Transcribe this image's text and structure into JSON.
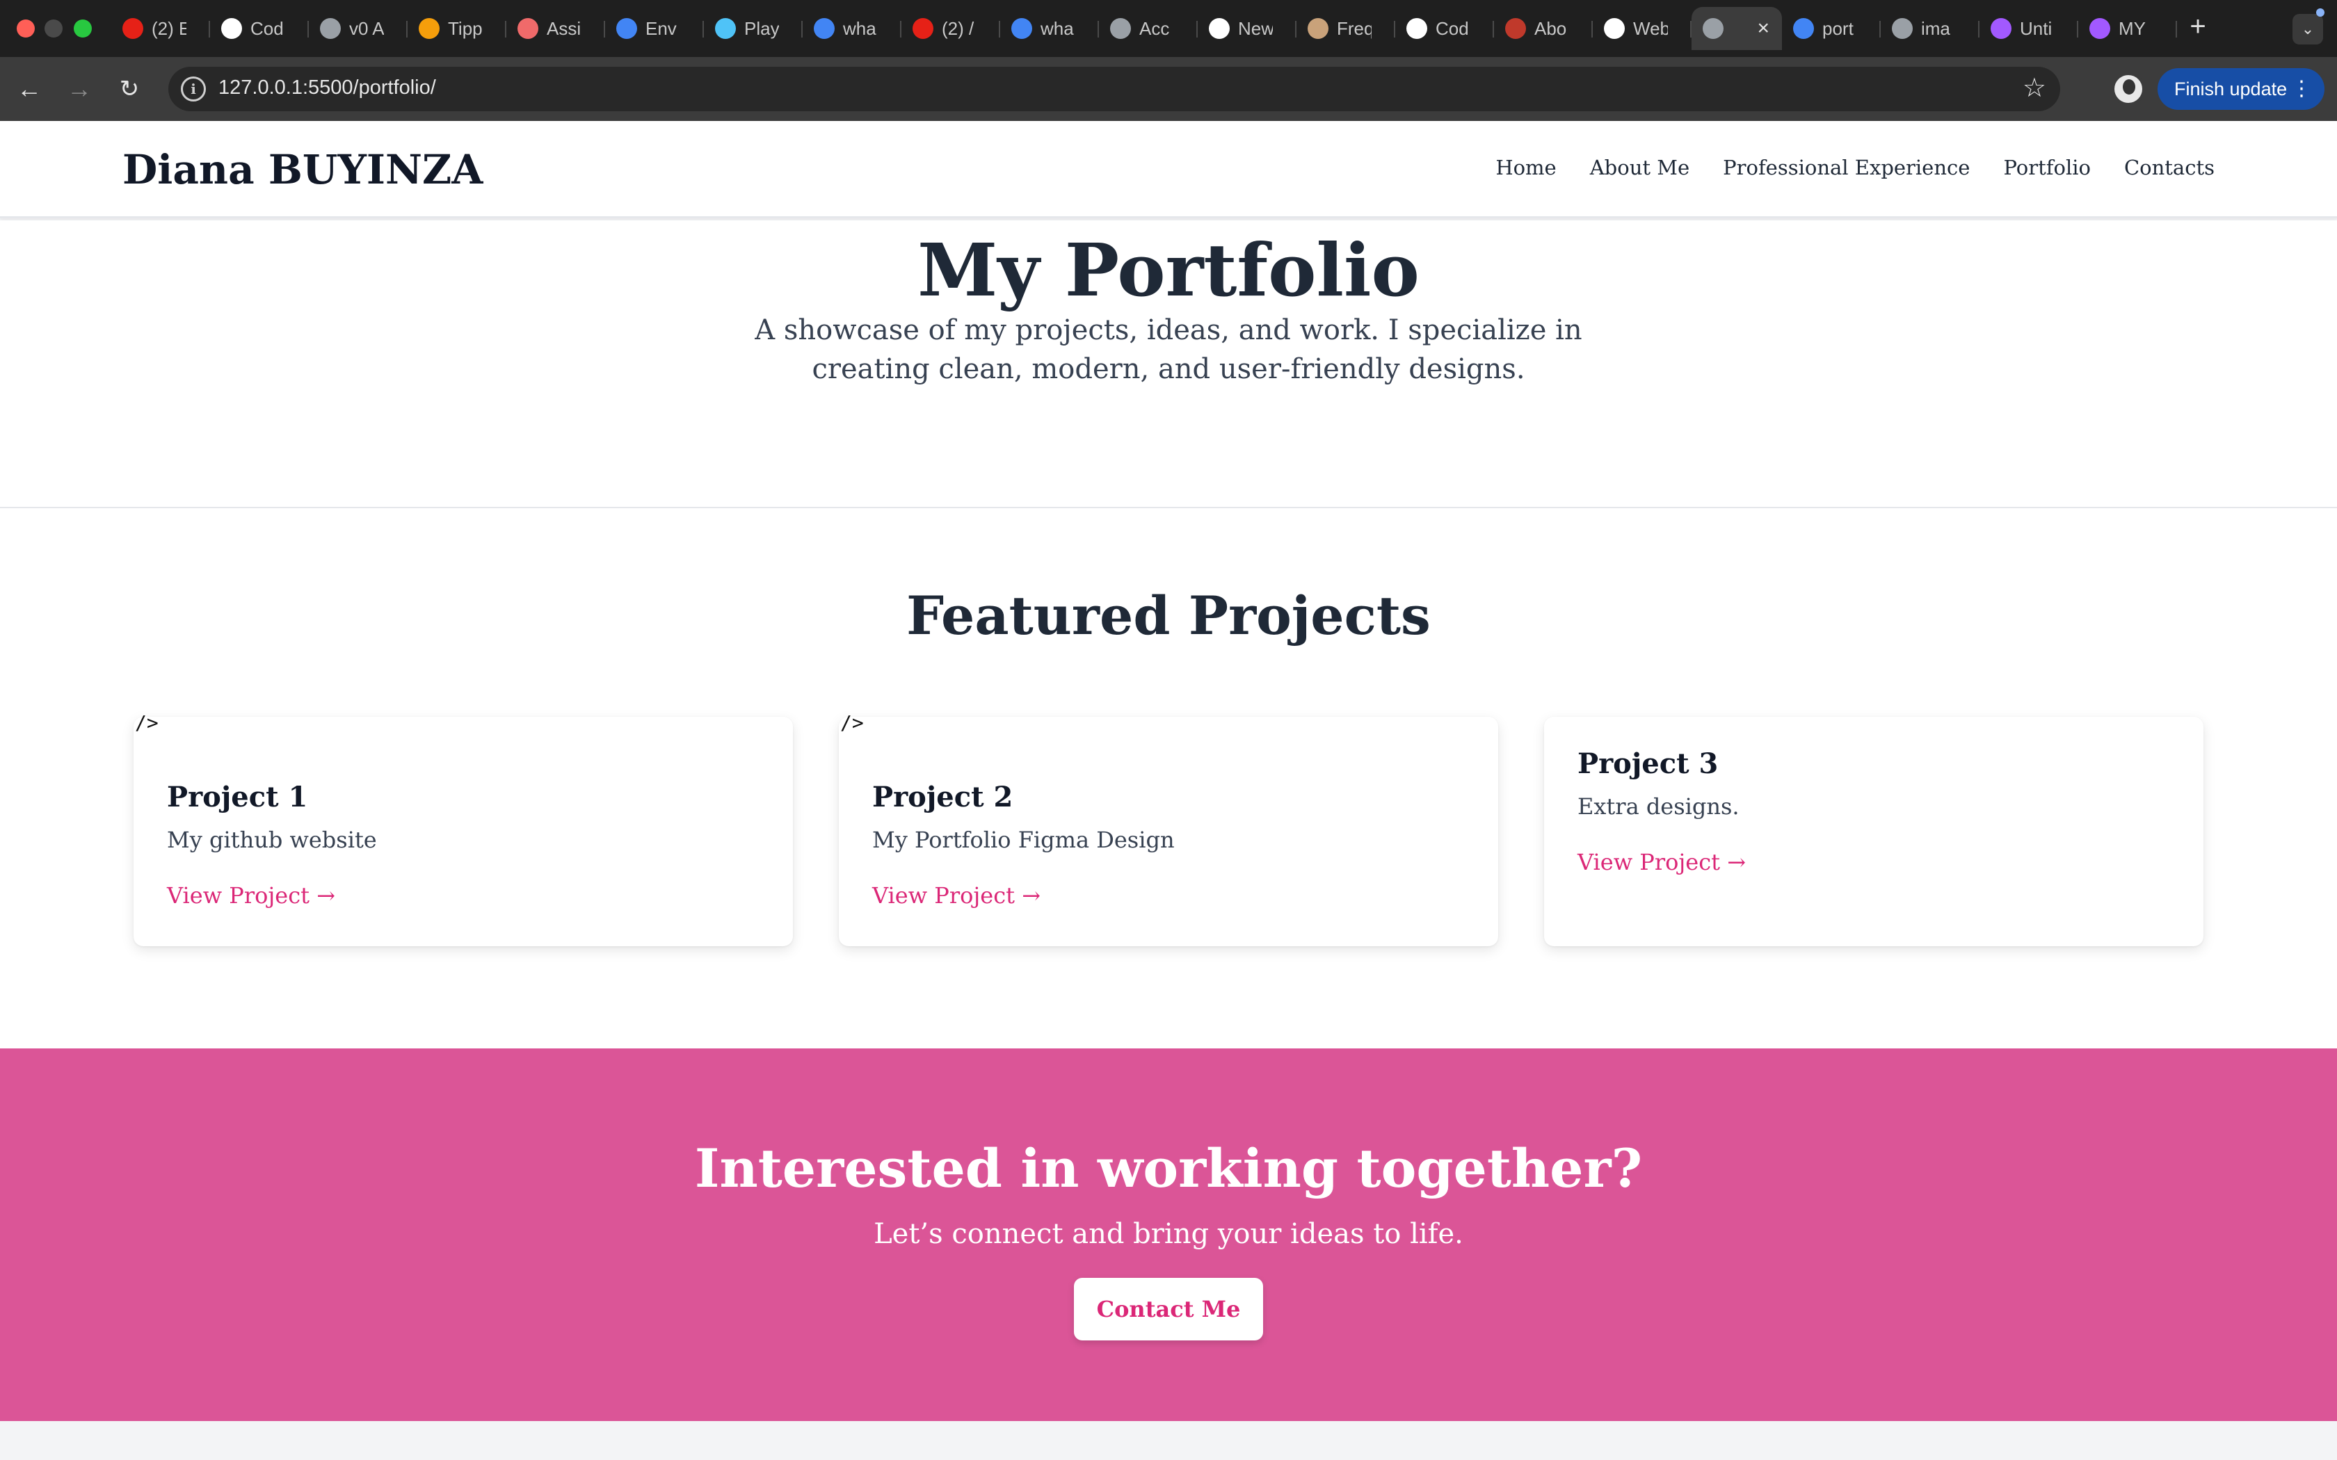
{
  "browser": {
    "tabs": [
      {
        "title": "(2) E",
        "icon": "youtube-icon",
        "color": "#e62117"
      },
      {
        "title": "Cod",
        "icon": "codepen-icon",
        "color": "#ffffff"
      },
      {
        "title": "v0 A",
        "icon": "globe-icon",
        "color": "#9aa0a6"
      },
      {
        "title": "Tipp",
        "icon": "tipp-icon",
        "color": "#f59e0b"
      },
      {
        "title": "Assi",
        "icon": "asana-icon",
        "color": "#f06a6a"
      },
      {
        "title": "Env",
        "icon": "flag-icon",
        "color": "#4285f4"
      },
      {
        "title": "Play",
        "icon": "play-icon",
        "color": "#4fc3f7"
      },
      {
        "title": "wha",
        "icon": "google-icon",
        "color": "#4285f4"
      },
      {
        "title": "(2) /",
        "icon": "youtube-icon",
        "color": "#e62117"
      },
      {
        "title": "wha",
        "icon": "google-icon",
        "color": "#4285f4"
      },
      {
        "title": "Acc",
        "icon": "plane-icon",
        "color": "#9aa0a6"
      },
      {
        "title": "New",
        "icon": "github-icon",
        "color": "#ffffff"
      },
      {
        "title": "Freq",
        "icon": "free-icon",
        "color": "#c9a27a"
      },
      {
        "title": "Cod",
        "icon": "openai-icon",
        "color": "#ffffff"
      },
      {
        "title": "Abo",
        "icon": "t-icon",
        "color": "#c0392b"
      },
      {
        "title": "Web",
        "icon": "openai-icon",
        "color": "#ffffff"
      },
      {
        "title": "",
        "icon": "globe-icon",
        "color": "#9aa0a6",
        "active": true
      },
      {
        "title": "port",
        "icon": "google-icon",
        "color": "#4285f4"
      },
      {
        "title": "ima",
        "icon": "globe-icon",
        "color": "#9aa0a6"
      },
      {
        "title": "Unti",
        "icon": "figma-icon",
        "color": "#a259ff"
      },
      {
        "title": "MY",
        "icon": "figma-icon",
        "color": "#a259ff"
      }
    ],
    "url": "127.0.0.1:5500/portfolio/",
    "finish_update": "Finish update"
  },
  "site": {
    "brand": "Diana BUYINZA",
    "nav": [
      "Home",
      "About Me",
      "Professional Experience",
      "Portfolio",
      "Contacts"
    ]
  },
  "hero": {
    "title": "My Portfolio",
    "subtitle": "A showcase of my projects, ideas, and work. I specialize in creating clean, modern, and user-friendly designs."
  },
  "projects": {
    "heading": "Featured Projects",
    "items": [
      {
        "alt": "/>",
        "title": "Project 1",
        "description": "My github website",
        "link": "View Project →"
      },
      {
        "alt": "/>",
        "title": "Project 2",
        "description": "My Portfolio Figma Design",
        "link": "View Project →"
      },
      {
        "alt": "",
        "title": "Project 3",
        "description": "Extra designs.",
        "link": "View Project →"
      }
    ]
  },
  "cta": {
    "heading": "Interested in working together?",
    "text": "Let’s connect and bring your ideas to life.",
    "button": "Contact Me"
  },
  "colors": {
    "accent": "#db2777",
    "cta_bg": "#db5597",
    "heading": "#1f2937"
  }
}
